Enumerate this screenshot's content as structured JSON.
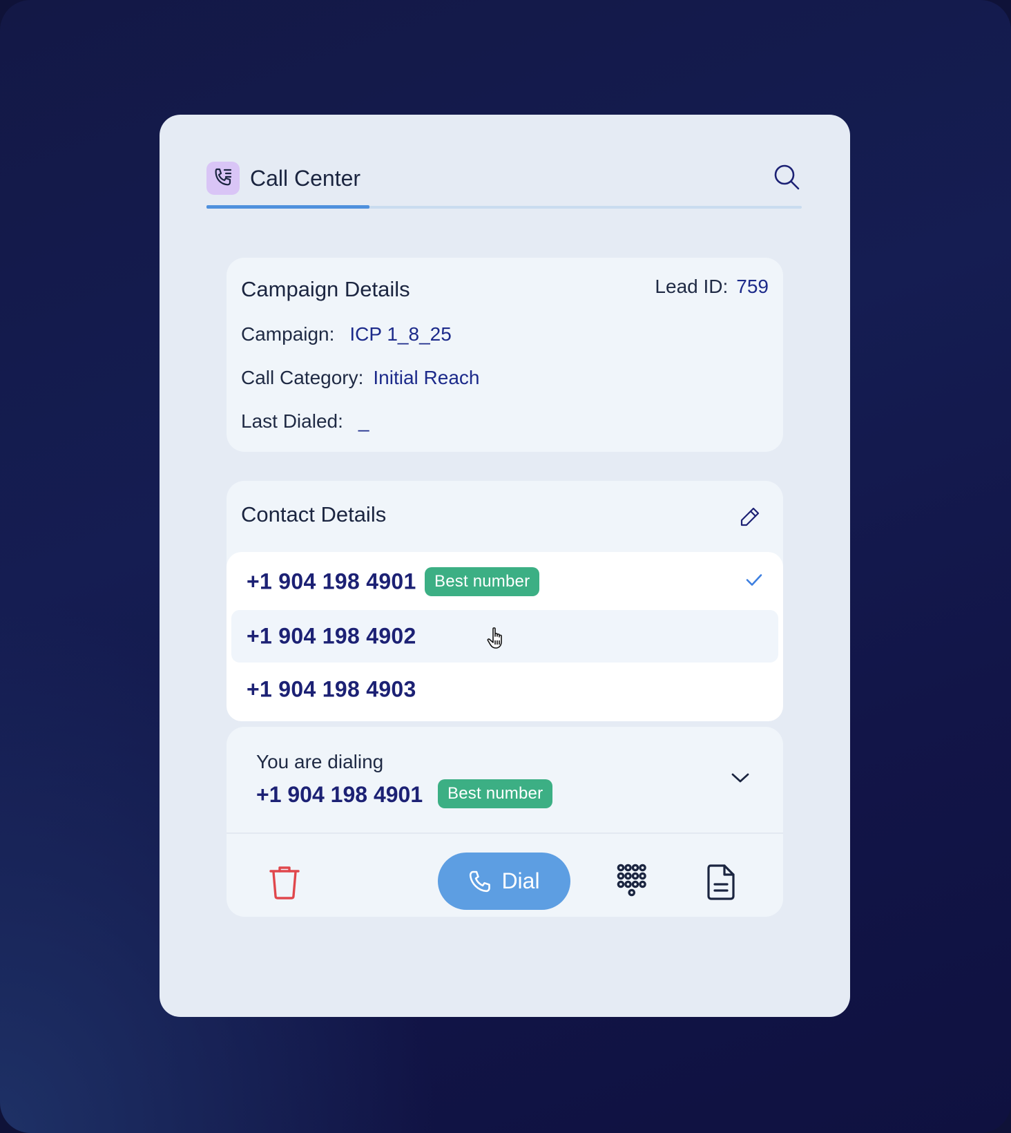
{
  "header": {
    "title": "Call Center",
    "icon": "phone-list-icon",
    "search_icon": "search-icon"
  },
  "campaign": {
    "title": "Campaign Details",
    "lead_label": "Lead ID:",
    "lead_value": "759",
    "campaign_label": "Campaign:",
    "campaign_value": "ICP 1_8_25",
    "category_label": "Call Category:",
    "category_value": "Initial Reach",
    "last_dialed_label": "Last Dialed:",
    "last_dialed_value": "_"
  },
  "contact": {
    "title": "Contact Details",
    "edit_icon": "pencil-icon",
    "numbers": [
      {
        "number": "+1 904 198 4901",
        "badge": "Best number",
        "selected": true
      },
      {
        "number": "+1 904 198 4902",
        "badge": "",
        "selected": false
      },
      {
        "number": "+1 904 198 4903",
        "badge": "",
        "selected": false
      }
    ]
  },
  "dialing": {
    "label": "You are dialing",
    "number": "+1 904 198 4901",
    "badge": "Best number",
    "actions": {
      "dial_label": "Dial",
      "delete_icon": "trash-icon",
      "keypad_icon": "keypad-icon",
      "notes_icon": "document-icon"
    }
  },
  "colors": {
    "accent": "#5d9ee2",
    "badge": "#3caf84",
    "danger": "#e0474c",
    "number_text": "#1c2174"
  }
}
